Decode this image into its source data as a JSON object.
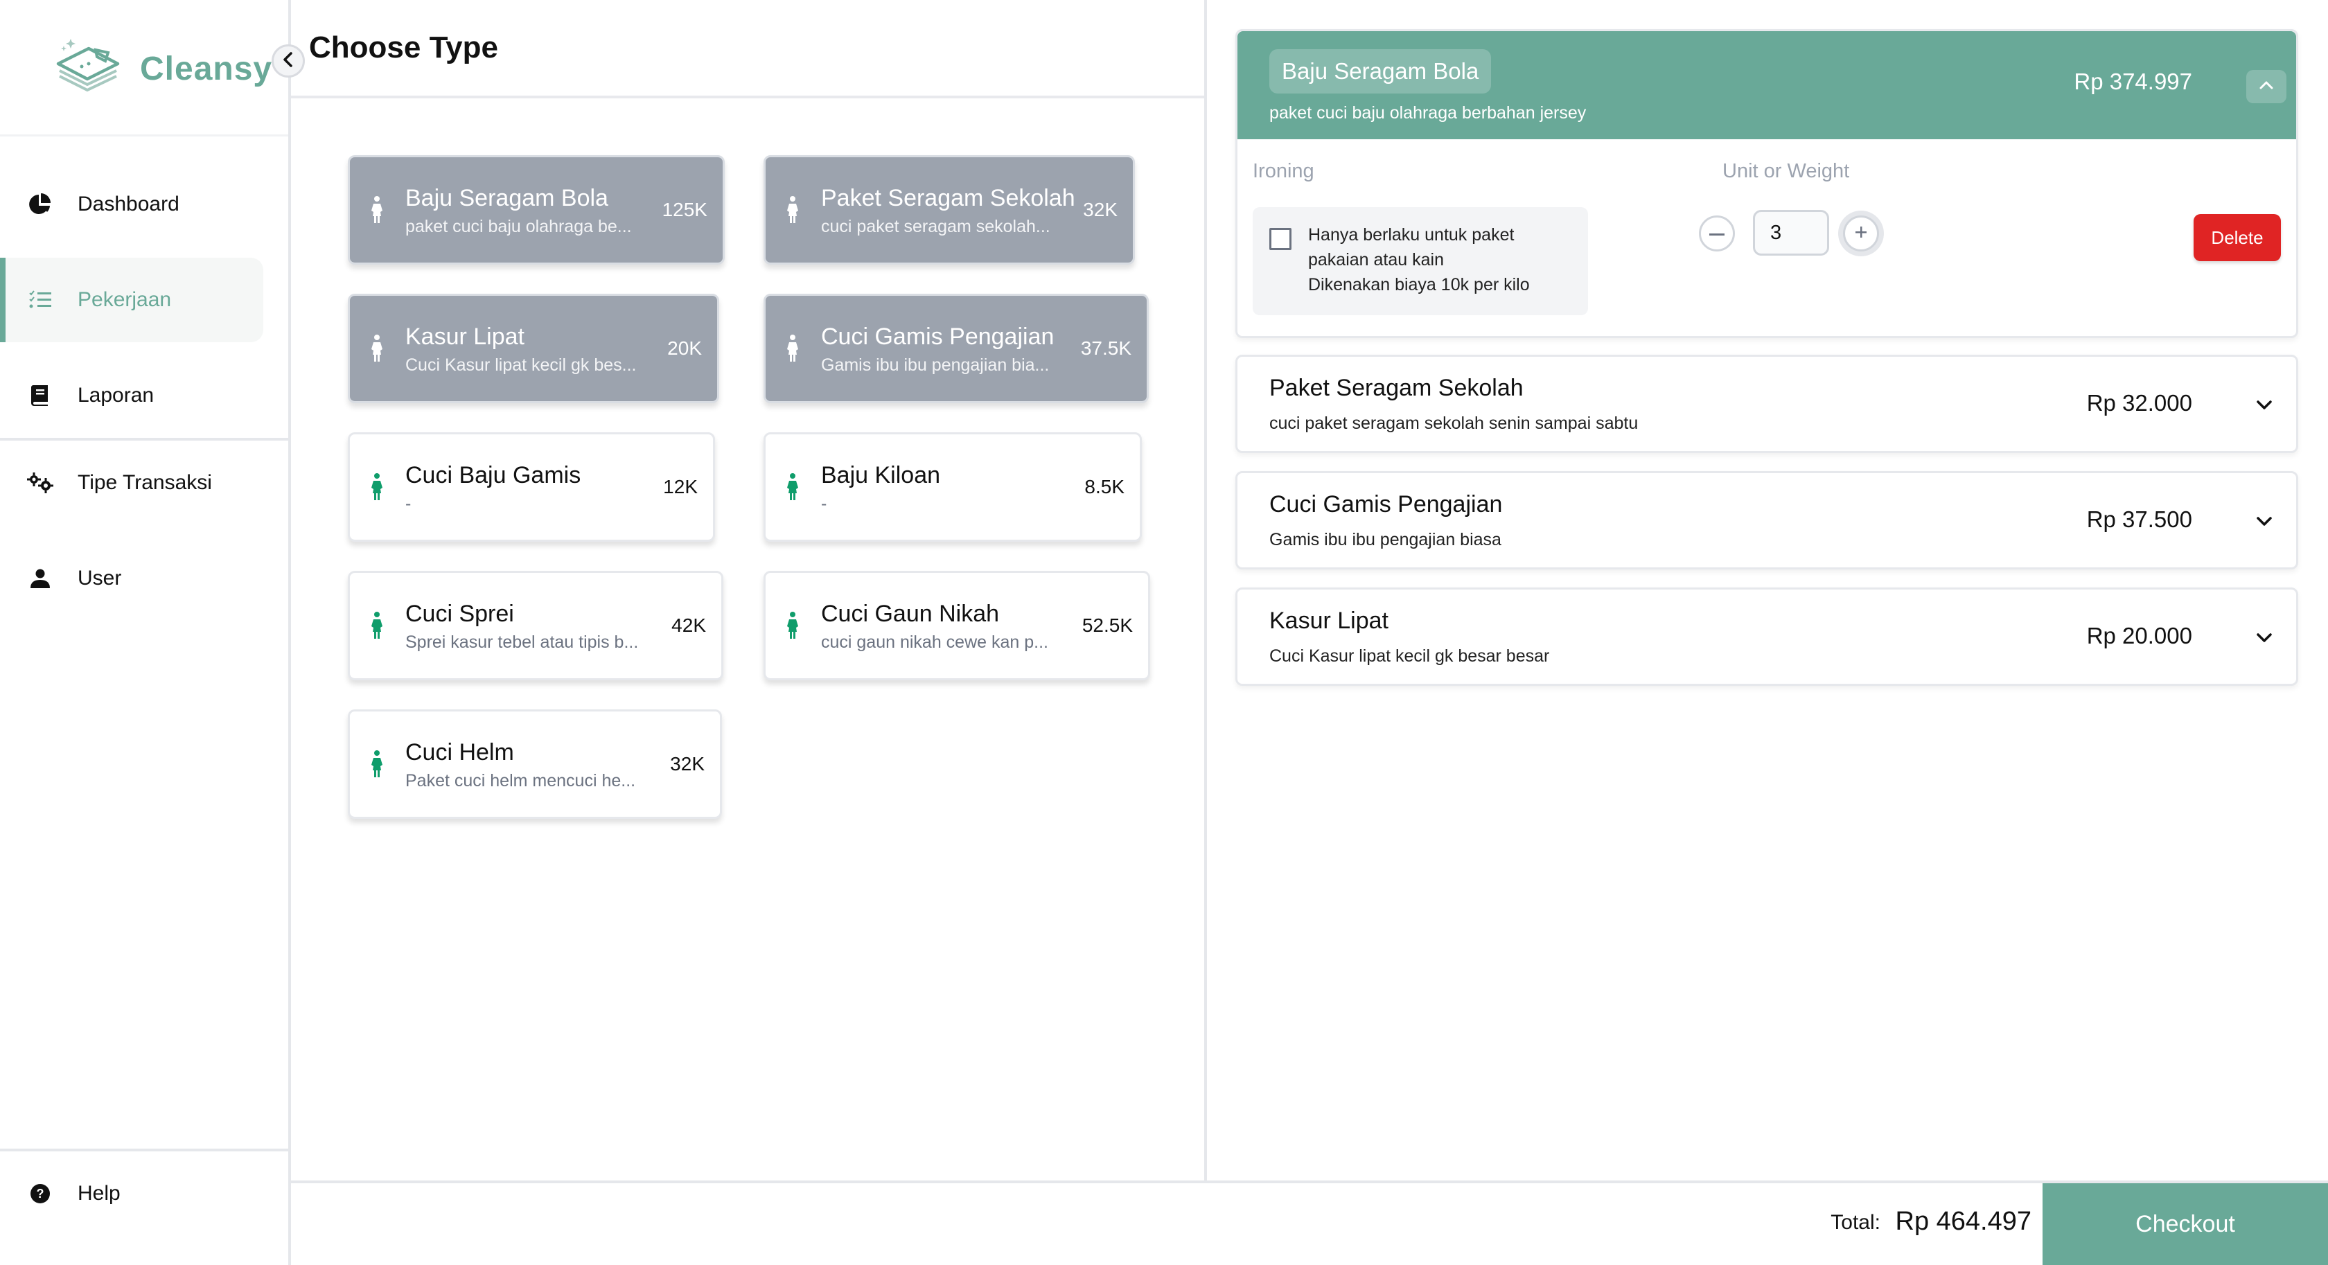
{
  "app": {
    "brand": "Cleansy",
    "logo_icon": "folded-laundry-icon",
    "collapse_sidebar_icon": "chevron-left-icon"
  },
  "sidebar": {
    "items": [
      {
        "label": "Dashboard",
        "icon": "pie-chart-icon",
        "active": false
      },
      {
        "label": "Pekerjaan",
        "icon": "checklist-icon",
        "active": true
      },
      {
        "label": "Laporan",
        "icon": "book-icon",
        "active": false
      },
      {
        "label": "Tipe Transaksi",
        "icon": "gears-icon",
        "active": false
      },
      {
        "label": "User",
        "icon": "user-icon",
        "active": false
      }
    ],
    "help": {
      "label": "Help",
      "icon": "question-circle-icon"
    }
  },
  "main": {
    "title": "Choose Type",
    "types": [
      {
        "name": "Baju Seragam Bola",
        "desc": "paket cuci baju olahraga be...",
        "price": "125K",
        "selected": true,
        "icon": "person-icon"
      },
      {
        "name": "Paket Seragam Sekolah",
        "desc": "cuci paket seragam sekolah...",
        "price": "32K",
        "selected": true,
        "icon": "person-icon"
      },
      {
        "name": "Kasur Lipat",
        "desc": "Cuci Kasur lipat kecil gk bes...",
        "price": "20K",
        "selected": true,
        "icon": "person-icon"
      },
      {
        "name": "Cuci Gamis Pengajian",
        "desc": "Gamis ibu ibu pengajian bia...",
        "price": "37.5K",
        "selected": true,
        "icon": "person-icon"
      },
      {
        "name": "Cuci Baju Gamis",
        "desc": "-",
        "price": "12K",
        "selected": false,
        "icon": "person-icon"
      },
      {
        "name": "Baju Kiloan",
        "desc": "-",
        "price": "8.5K",
        "selected": false,
        "icon": "person-icon"
      },
      {
        "name": "Cuci Sprei",
        "desc": "Sprei kasur tebel atau tipis b...",
        "price": "42K",
        "selected": false,
        "icon": "person-icon"
      },
      {
        "name": "Cuci Gaun Nikah",
        "desc": "cuci gaun nikah cewe kan p...",
        "price": "52.5K",
        "selected": false,
        "icon": "person-icon"
      },
      {
        "name": "Cuci Helm",
        "desc": "Paket cuci helm mencuci he...",
        "price": "32K",
        "selected": false,
        "icon": "person-icon"
      }
    ]
  },
  "cart": {
    "expanded": {
      "name": "Baju Seragam Bola",
      "desc": "paket cuci baju olahraga berbahan jersey",
      "price": "Rp 374.997",
      "ironing_label": "Ironing",
      "ironing_checked": false,
      "ironing_text_1": "Hanya berlaku untuk paket",
      "ironing_text_2": "pakaian atau kain",
      "ironing_text_3": "Dikenakan biaya 10k per kilo",
      "unit_label": "Unit or Weight",
      "quantity": "3",
      "delete_label": "Delete"
    },
    "items": [
      {
        "name": "Paket Seragam Sekolah",
        "desc": "cuci paket seragam sekolah senin sampai sabtu",
        "price": "Rp 32.000"
      },
      {
        "name": "Cuci Gamis Pengajian",
        "desc": "Gamis ibu ibu pengajian biasa",
        "price": "Rp 37.500"
      },
      {
        "name": "Kasur Lipat",
        "desc": "Cuci Kasur lipat kecil gk besar besar",
        "price": "Rp 20.000"
      }
    ]
  },
  "footer": {
    "total_label": "Total:",
    "total_value": "Rp 464.497",
    "checkout_label": "Checkout"
  },
  "colors": {
    "brand": "#69a998",
    "selected_card": "#9ca3ae",
    "danger": "#e02424",
    "person_icon_green": "#0f9d6b"
  }
}
